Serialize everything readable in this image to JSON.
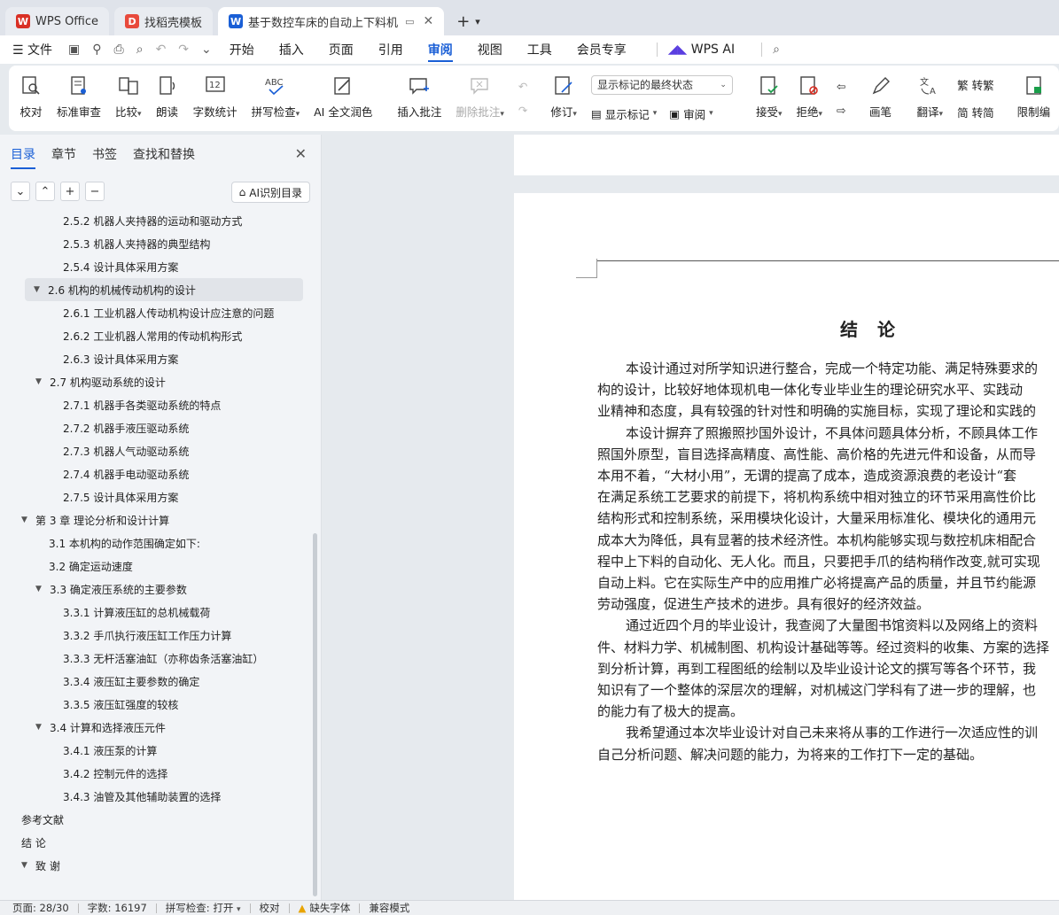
{
  "tabs": [
    {
      "label": "WPS Office",
      "logo": "W",
      "color": "#d93025"
    },
    {
      "label": "找稻壳模板",
      "logo": "D",
      "color": "#e84a3c"
    },
    {
      "label": "基于数控车床的自动上下料机",
      "logo": "W",
      "color": "#1a5fd6"
    }
  ],
  "menu": {
    "file": "文件",
    "tabs": [
      "开始",
      "插入",
      "页面",
      "引用",
      "审阅",
      "视图",
      "工具",
      "会员专享"
    ],
    "active_tab": "审阅",
    "wps_ai": "WPS AI"
  },
  "ribbon": {
    "proof": "校对",
    "std_review": "标准审查",
    "compare": "比较",
    "read_aloud": "朗读",
    "word_count": "字数统计",
    "spell_check": "拼写检查",
    "ai_polish": "AI 全文润色",
    "insert_comment": "插入批注",
    "delete_comment": "删除批注",
    "track_changes": "修订",
    "display_select": "显示标记的最终状态",
    "show_markup": "显示标记",
    "review": "审阅",
    "accept": "接受",
    "reject": "拒绝",
    "pen": "画笔",
    "translate": "翻译",
    "to_traditional": "转繁",
    "to_simplified": "转简",
    "restrict": "限制编"
  },
  "nav": {
    "tabs": [
      "目录",
      "章节",
      "书签",
      "查找和替换"
    ],
    "ai_toc": "AI识别目录",
    "items": [
      {
        "label": "2.5.2 机器人夹持器的运动和驱动方式",
        "level": 3
      },
      {
        "label": "2.5.3  机器人夹持器的典型结构",
        "level": 3
      },
      {
        "label": "2.5.4 设计具体采用方案",
        "level": 3
      },
      {
        "label": "2.6 机构的机械传动机构的设计",
        "level": 2,
        "expanded": true,
        "selected": true
      },
      {
        "label": "2.6.1 工业机器人传动机构设计应注意的问题",
        "level": 3
      },
      {
        "label": "2.6.2 工业机器人常用的传动机构形式",
        "level": 3
      },
      {
        "label": "2.6.3  设计具体采用方案",
        "level": 3
      },
      {
        "label": "2.7 机构驱动系统的设计",
        "level": 2,
        "expanded": true
      },
      {
        "label": "2.7.1 机器手各类驱动系统的特点",
        "level": 3
      },
      {
        "label": "2.7.2 机器手液压驱动系统",
        "level": 3
      },
      {
        "label": "2.7.3  机器人气动驱动系统",
        "level": 3
      },
      {
        "label": "2.7.4 机器手电动驱动系统",
        "level": 3
      },
      {
        "label": "2.7.5 设计具体采用方案",
        "level": 3
      },
      {
        "label": "第 3 章   理论分析和设计计算",
        "level": 1,
        "expanded": true
      },
      {
        "label": "3.1 本机构的动作范围确定如下:",
        "level": 2
      },
      {
        "label": "3.2  确定运动速度",
        "level": 2
      },
      {
        "label": "3.3 确定液压系统的主要参数",
        "level": 2,
        "expanded": true
      },
      {
        "label": "3.3.1 计算液压缸的总机械载荷",
        "level": 3
      },
      {
        "label": "3.3.2 手爪执行液压缸工作压力计算",
        "level": 3
      },
      {
        "label": "3.3.3  无杆活塞油缸（亦称齿条活塞油缸）",
        "level": 3
      },
      {
        "label": "3.3.4 液压缸主要参数的确定",
        "level": 3
      },
      {
        "label": "3.3.5 液压缸强度的较核",
        "level": 3
      },
      {
        "label": "3.4 计算和选择液压元件",
        "level": 2,
        "expanded": true
      },
      {
        "label": "3.4.1 液压泵的计算",
        "level": 3
      },
      {
        "label": "3.4.2 控制元件的选择",
        "level": 3
      },
      {
        "label": "3.4.3 油管及其他辅助装置的选择",
        "level": 3
      },
      {
        "label": "参考文献",
        "level": 1
      },
      {
        "label": "结    论",
        "level": 1
      },
      {
        "label": "致     谢",
        "level": 1,
        "expanded": true
      }
    ]
  },
  "document": {
    "title": "结论",
    "lines": [
      {
        "text": "本设计通过对所学知识进行整合，完成一个特定功能、满足特殊要求的",
        "indent": true
      },
      {
        "text": "构的设计，比较好地体现机电一体化专业毕业生的理论研究水平、实践动",
        "indent": false
      },
      {
        "text": "业精神和态度，具有较强的针对性和明确的实施目标，实现了理论和实践的",
        "indent": false
      },
      {
        "text": "本设计摒弃了照搬照抄国外设计，不具体问题具体分析，不顾具体工作",
        "indent": true
      },
      {
        "text": "照国外原型，盲目选择高精度、高性能、高价格的先进元件和设备，从而导",
        "indent": false
      },
      {
        "text": "本用不着，“大材小用”，无谓的提高了成本，造成资源浪费的老设计“套",
        "indent": false
      },
      {
        "text": "在满足系统工艺要求的前提下，将机构系统中相对独立的环节采用高性价比",
        "indent": false
      },
      {
        "text": "结构形式和控制系统，采用模块化设计，大量采用标准化、模块化的通用元",
        "indent": false
      },
      {
        "text": "成本大为降低，具有显著的技术经济性。本机构能够实现与数控机床相配合",
        "indent": false
      },
      {
        "text": "程中上下料的自动化、无人化。而且，只要把手爪的结构稍作改变,就可实现",
        "indent": false
      },
      {
        "text": "自动上料。它在实际生产中的应用推广必将提高产品的质量，并且节约能源",
        "indent": false
      },
      {
        "text": "劳动强度，促进生产技术的进步。具有很好的经济效益。",
        "indent": false
      },
      {
        "text": "通过近四个月的毕业设计，我查阅了大量图书馆资料以及网络上的资料",
        "indent": true
      },
      {
        "text": "件、材料力学、机械制图、机构设计基础等等。经过资料的收集、方案的选择",
        "indent": false
      },
      {
        "text": "到分析计算，再到工程图纸的绘制以及毕业设计论文的撰写等各个环节，我",
        "indent": false
      },
      {
        "text": "知识有了一个整体的深层次的理解，对机械这门学科有了进一步的理解，也",
        "indent": false
      },
      {
        "text": "的能力有了极大的提高。",
        "indent": false
      },
      {
        "text": "我希望通过本次毕业设计对自己未来将从事的工作进行一次适应性的训",
        "indent": true
      },
      {
        "text": "自己分析问题、解决问题的能力，为将来的工作打下一定的基础。",
        "indent": false
      }
    ]
  },
  "status": {
    "page": "页面: 28/30",
    "words": "字数: 16197",
    "spell": "拼写检查: 打开",
    "proof": "校对",
    "missing_font": "缺失字体",
    "compat": "兼容模式"
  }
}
